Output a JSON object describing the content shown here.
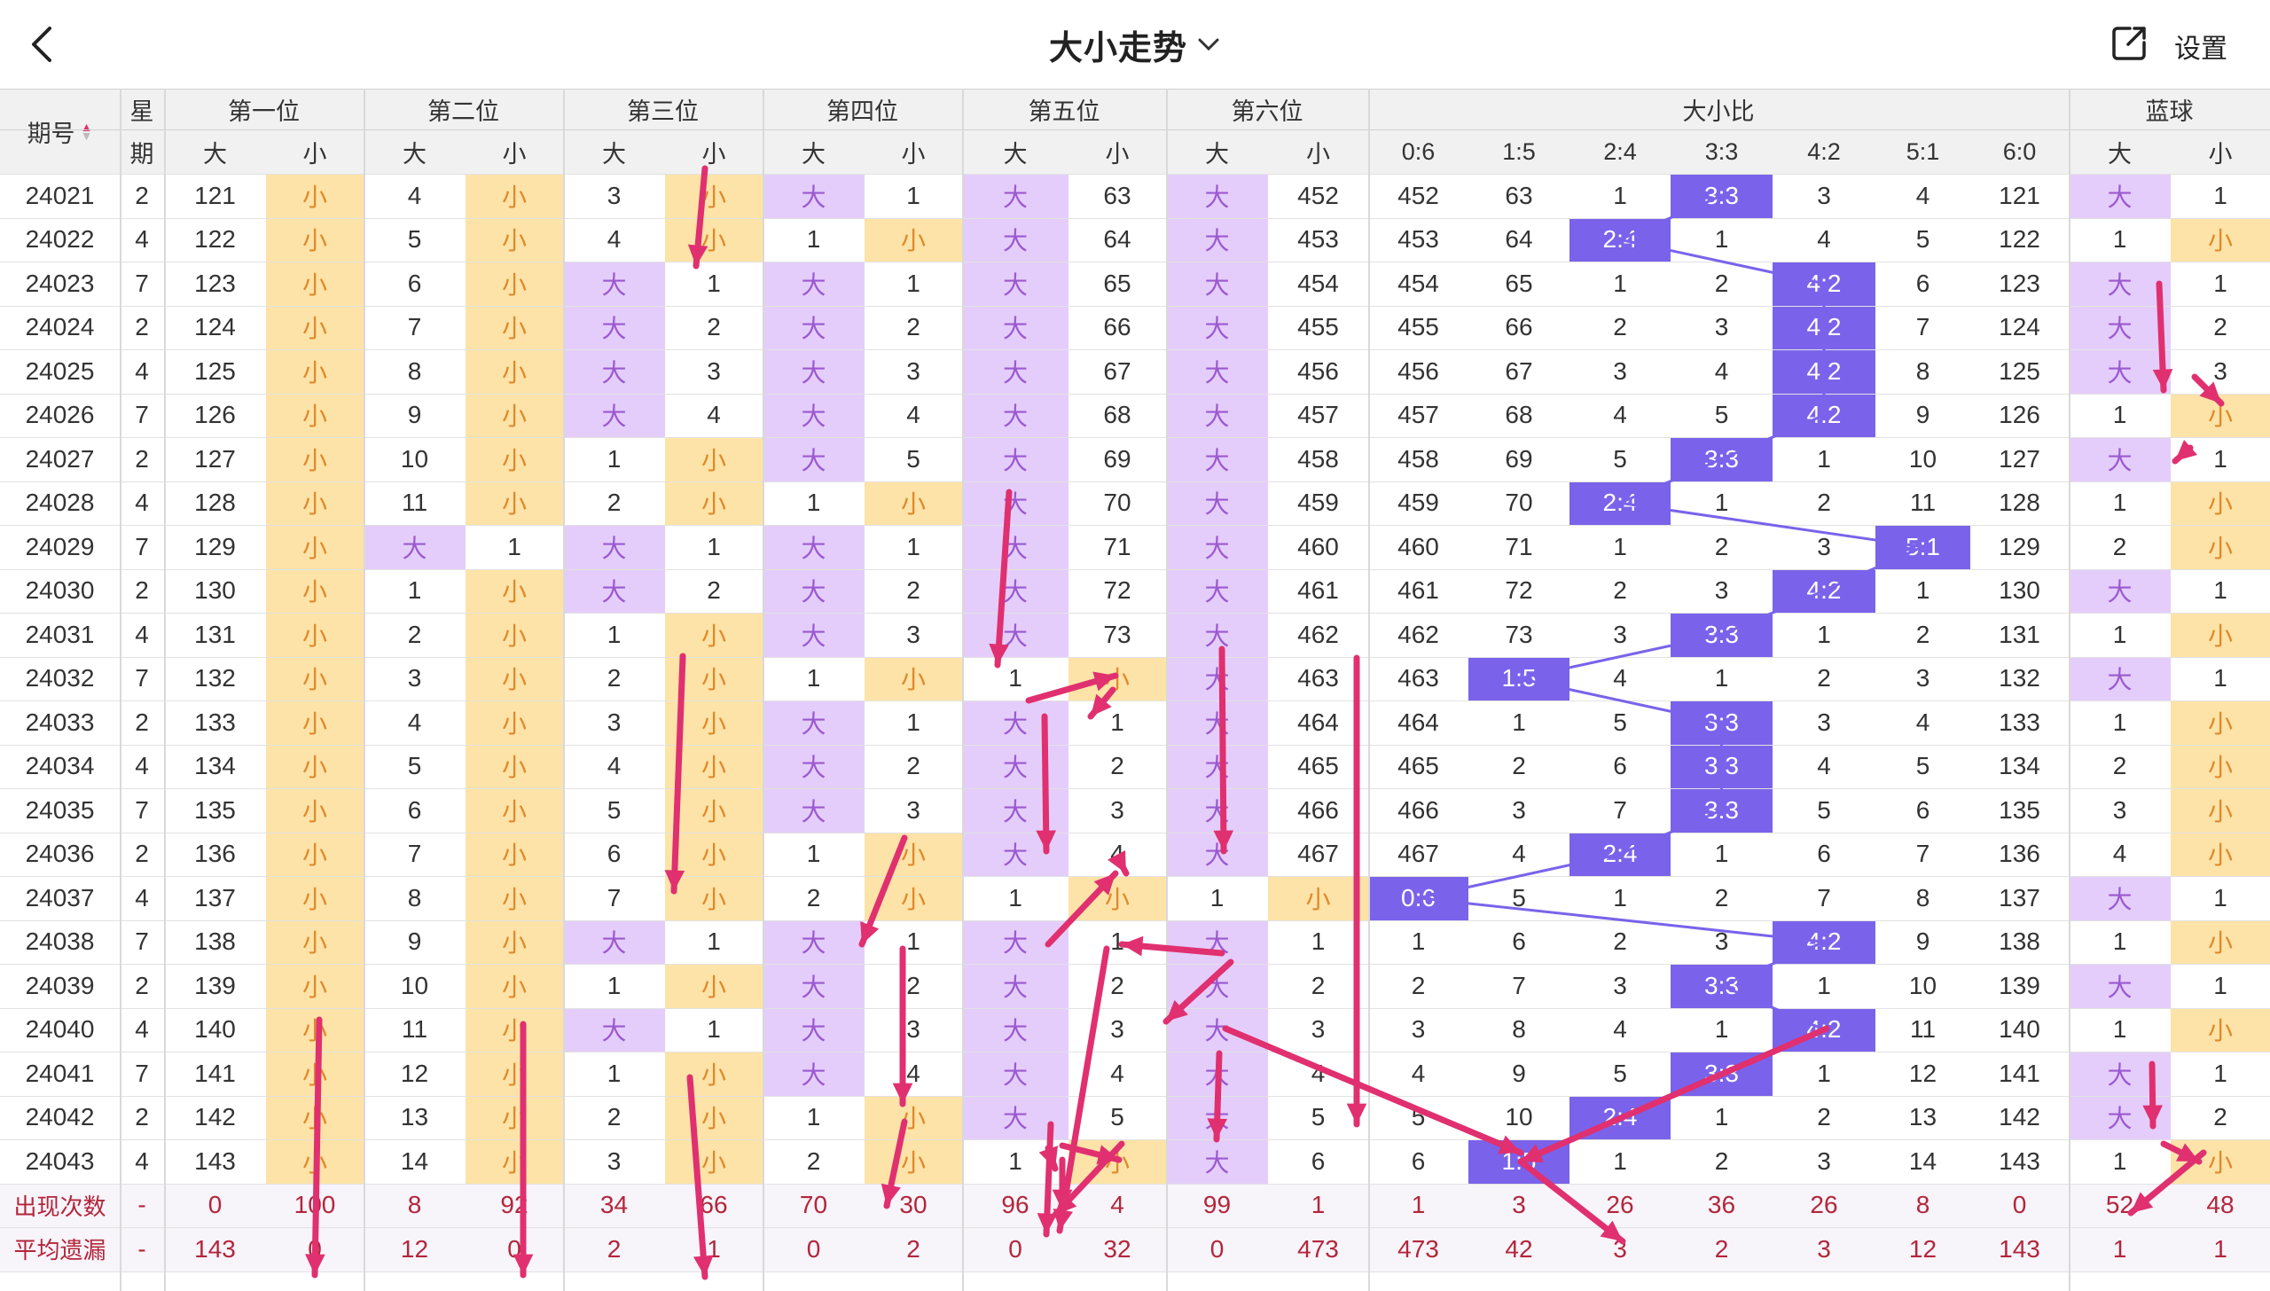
{
  "header": {
    "title": "大小走势",
    "settings_label": "设置"
  },
  "table": {
    "period_label": "期号",
    "weekday_label": "星期",
    "groups": [
      "第一位",
      "第二位",
      "第三位",
      "第四位",
      "第五位",
      "第六位",
      "大小比",
      "蓝球"
    ],
    "big_label": "大",
    "small_label": "小",
    "ratio_cols": [
      "0:6",
      "1:5",
      "2:4",
      "3:3",
      "4:2",
      "5:1",
      "6:0"
    ],
    "rows": [
      [
        "24021",
        "2",
        "121",
        "小",
        "4",
        "小",
        "3",
        "小",
        "大",
        "1",
        "大",
        "63",
        "大",
        "452",
        "452",
        "63",
        "1",
        "3:3",
        "3",
        "4",
        "121",
        "大",
        "1"
      ],
      [
        "24022",
        "4",
        "122",
        "小",
        "5",
        "小",
        "4",
        "小",
        "1",
        "小",
        "大",
        "64",
        "大",
        "453",
        "453",
        "64",
        "2:4",
        "1",
        "4",
        "5",
        "122",
        "1",
        "小"
      ],
      [
        "24023",
        "7",
        "123",
        "小",
        "6",
        "小",
        "大",
        "1",
        "大",
        "1",
        "大",
        "65",
        "大",
        "454",
        "454",
        "65",
        "1",
        "2",
        "4:2",
        "6",
        "123",
        "大",
        "1"
      ],
      [
        "24024",
        "2",
        "124",
        "小",
        "7",
        "小",
        "大",
        "2",
        "大",
        "2",
        "大",
        "66",
        "大",
        "455",
        "455",
        "66",
        "2",
        "3",
        "4:2",
        "7",
        "124",
        "大",
        "2"
      ],
      [
        "24025",
        "4",
        "125",
        "小",
        "8",
        "小",
        "大",
        "3",
        "大",
        "3",
        "大",
        "67",
        "大",
        "456",
        "456",
        "67",
        "3",
        "4",
        "4:2",
        "8",
        "125",
        "大",
        "3"
      ],
      [
        "24026",
        "7",
        "126",
        "小",
        "9",
        "小",
        "大",
        "4",
        "大",
        "4",
        "大",
        "68",
        "大",
        "457",
        "457",
        "68",
        "4",
        "5",
        "4:2",
        "9",
        "126",
        "1",
        "小"
      ],
      [
        "24027",
        "2",
        "127",
        "小",
        "10",
        "小",
        "1",
        "小",
        "大",
        "5",
        "大",
        "69",
        "大",
        "458",
        "458",
        "69",
        "5",
        "3:3",
        "1",
        "10",
        "127",
        "大",
        "1"
      ],
      [
        "24028",
        "4",
        "128",
        "小",
        "11",
        "小",
        "2",
        "小",
        "1",
        "小",
        "大",
        "70",
        "大",
        "459",
        "459",
        "70",
        "2:4",
        "1",
        "2",
        "11",
        "128",
        "1",
        "小"
      ],
      [
        "24029",
        "7",
        "129",
        "小",
        "大",
        "1",
        "大",
        "1",
        "大",
        "1",
        "大",
        "71",
        "大",
        "460",
        "460",
        "71",
        "1",
        "2",
        "3",
        "5:1",
        "129",
        "2",
        "小"
      ],
      [
        "24030",
        "2",
        "130",
        "小",
        "1",
        "小",
        "大",
        "2",
        "大",
        "2",
        "大",
        "72",
        "大",
        "461",
        "461",
        "72",
        "2",
        "3",
        "4:2",
        "1",
        "130",
        "大",
        "1"
      ],
      [
        "24031",
        "4",
        "131",
        "小",
        "2",
        "小",
        "1",
        "小",
        "大",
        "3",
        "大",
        "73",
        "大",
        "462",
        "462",
        "73",
        "3",
        "3:3",
        "1",
        "2",
        "131",
        "1",
        "小"
      ],
      [
        "24032",
        "7",
        "132",
        "小",
        "3",
        "小",
        "2",
        "小",
        "1",
        "小",
        "1",
        "小",
        "大",
        "463",
        "463",
        "1:5",
        "4",
        "1",
        "2",
        "3",
        "132",
        "大",
        "1"
      ],
      [
        "24033",
        "2",
        "133",
        "小",
        "4",
        "小",
        "3",
        "小",
        "大",
        "1",
        "大",
        "1",
        "大",
        "464",
        "464",
        "1",
        "5",
        "3:3",
        "3",
        "4",
        "133",
        "1",
        "小"
      ],
      [
        "24034",
        "4",
        "134",
        "小",
        "5",
        "小",
        "4",
        "小",
        "大",
        "2",
        "大",
        "2",
        "大",
        "465",
        "465",
        "2",
        "6",
        "3:3",
        "4",
        "5",
        "134",
        "2",
        "小"
      ],
      [
        "24035",
        "7",
        "135",
        "小",
        "6",
        "小",
        "5",
        "小",
        "大",
        "3",
        "大",
        "3",
        "大",
        "466",
        "466",
        "3",
        "7",
        "3:3",
        "5",
        "6",
        "135",
        "3",
        "小"
      ],
      [
        "24036",
        "2",
        "136",
        "小",
        "7",
        "小",
        "6",
        "小",
        "1",
        "小",
        "大",
        "4",
        "大",
        "467",
        "467",
        "4",
        "2:4",
        "1",
        "6",
        "7",
        "136",
        "4",
        "小"
      ],
      [
        "24037",
        "4",
        "137",
        "小",
        "8",
        "小",
        "7",
        "小",
        "2",
        "小",
        "1",
        "小",
        "1",
        "小",
        "0:6",
        "5",
        "1",
        "2",
        "7",
        "8",
        "137",
        "大",
        "1"
      ],
      [
        "24038",
        "7",
        "138",
        "小",
        "9",
        "小",
        "大",
        "1",
        "大",
        "1",
        "大",
        "1",
        "大",
        "1",
        "1",
        "6",
        "2",
        "3",
        "4:2",
        "9",
        "138",
        "1",
        "小"
      ],
      [
        "24039",
        "2",
        "139",
        "小",
        "10",
        "小",
        "1",
        "小",
        "大",
        "2",
        "大",
        "2",
        "大",
        "2",
        "2",
        "7",
        "3",
        "3:3",
        "1",
        "10",
        "139",
        "大",
        "1"
      ],
      [
        "24040",
        "4",
        "140",
        "小",
        "11",
        "小",
        "大",
        "1",
        "大",
        "3",
        "大",
        "3",
        "大",
        "3",
        "3",
        "8",
        "4",
        "1",
        "4:2",
        "11",
        "140",
        "1",
        "小"
      ],
      [
        "24041",
        "7",
        "141",
        "小",
        "12",
        "小",
        "1",
        "小",
        "大",
        "4",
        "大",
        "4",
        "大",
        "4",
        "4",
        "9",
        "5",
        "3:3",
        "1",
        "12",
        "141",
        "大",
        "1"
      ],
      [
        "24042",
        "2",
        "142",
        "小",
        "13",
        "小",
        "2",
        "小",
        "1",
        "小",
        "大",
        "5",
        "大",
        "5",
        "5",
        "10",
        "2:4",
        "1",
        "2",
        "13",
        "142",
        "大",
        "2"
      ],
      [
        "24043",
        "4",
        "143",
        "小",
        "14",
        "小",
        "3",
        "小",
        "2",
        "小",
        "1",
        "小",
        "大",
        "6",
        "6",
        "1:5",
        "1",
        "2",
        "3",
        "14",
        "143",
        "1",
        "小"
      ]
    ],
    "stat_rows": [
      [
        "出现次数",
        "-",
        "0",
        "100",
        "8",
        "92",
        "34",
        "66",
        "70",
        "30",
        "96",
        "4",
        "99",
        "1",
        "1",
        "3",
        "26",
        "36",
        "26",
        "8",
        "0",
        "52",
        "48"
      ],
      [
        "平均遗漏",
        "-",
        "143",
        "0",
        "12",
        "0",
        "2",
        "1",
        "0",
        "2",
        "0",
        "32",
        "0",
        "473",
        "473",
        "42",
        "3",
        "2",
        "3",
        "12",
        "143",
        "1",
        "1"
      ]
    ]
  },
  "colors": {
    "big": "#e4cdfa",
    "small": "#fde3a7",
    "ratio": "#7a63ea",
    "arrow": "#e0306f",
    "big_text": "#9b59d0",
    "small_text": "#e0892b",
    "stat_text": "#b3263b"
  }
}
